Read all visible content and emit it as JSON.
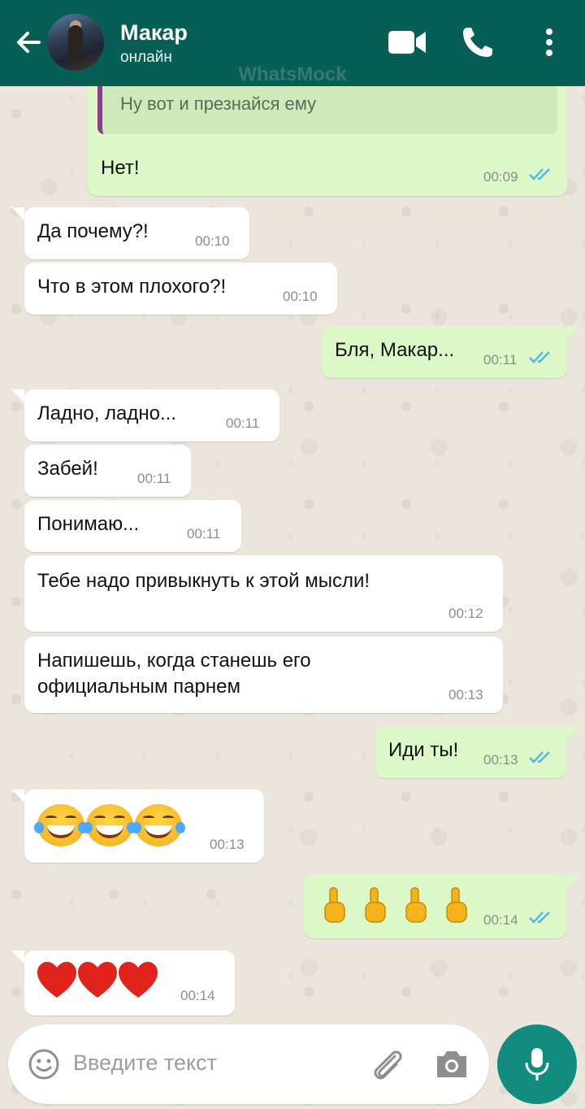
{
  "header": {
    "contact_name": "Макар",
    "status": "онлайн",
    "watermark": "WhatsMock",
    "icons": [
      "back-arrow-icon",
      "video-call-icon",
      "phone-icon",
      "more-vert-icon"
    ]
  },
  "colors": {
    "header": "#075e54",
    "incoming": "#ffffff",
    "outgoing": "#dcf8c6",
    "read_ticks": "#4fb6ec",
    "mic_button": "#128c7e"
  },
  "messages": [
    {
      "dir": "out",
      "quote": "Ну вот и презнайся ему",
      "text": "Нет!",
      "time": "00:09",
      "read": true
    },
    {
      "dir": "in",
      "text": "Да почему?!",
      "time": "00:10"
    },
    {
      "dir": "in",
      "text": "Что в этом плохого?!",
      "time": "00:10"
    },
    {
      "dir": "out",
      "text": "Бля, Макар...",
      "time": "00:11",
      "read": true
    },
    {
      "dir": "in",
      "text": "Ладно, ладно...",
      "time": "00:11"
    },
    {
      "dir": "in",
      "text": "Забей!",
      "time": "00:11"
    },
    {
      "dir": "in",
      "text": "Понимаю...",
      "time": "00:11"
    },
    {
      "dir": "in",
      "text": "Тебе надо привыкнуть к этой мысли!",
      "time": "00:12"
    },
    {
      "dir": "in",
      "text_line1": "Напишешь, когда станешь его",
      "text_line2": "официальным парнем",
      "time": "00:13"
    },
    {
      "dir": "out",
      "text": "Иди ты!",
      "time": "00:13",
      "read": true
    },
    {
      "dir": "in",
      "emoji": "😂😂😂",
      "emoji_name": "face-with-tears-of-joy",
      "time": "00:13"
    },
    {
      "dir": "out",
      "emoji": "🖕🖕🖕🖕",
      "emoji_name": "middle-finger",
      "time": "00:14",
      "read": true
    },
    {
      "dir": "in",
      "emoji": "❤️❤️❤️",
      "emoji_name": "red-heart",
      "time": "00:14"
    }
  ],
  "input": {
    "placeholder": "Введите текст",
    "icons": [
      "emoji-icon",
      "attach-icon",
      "camera-icon",
      "mic-icon"
    ]
  }
}
